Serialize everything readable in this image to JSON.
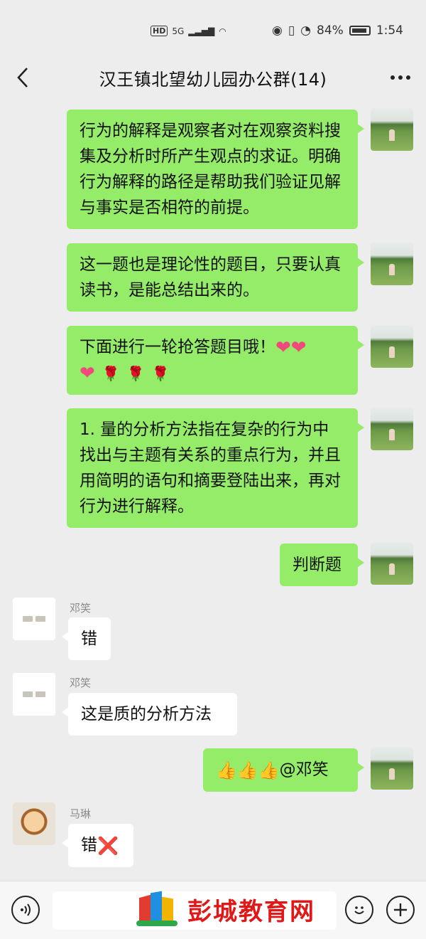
{
  "status_bar": {
    "hd": "HD",
    "network": "5G",
    "battery_percent": "84%",
    "time": "1:54"
  },
  "header": {
    "title": "汉王镇北望幼儿园办公群(14)"
  },
  "messages": [
    {
      "sender": "me",
      "text": "行为的解释是观察者对在观察资料搜集及分析时所产生观点的求证。明确行为解释的路径是帮助我们验证见解与事实是否相符的前提。"
    },
    {
      "sender": "me",
      "text": "这一题也是理论性的题目，只要认真读书，是能总结出来的。"
    },
    {
      "sender": "me",
      "text": "下面进行一轮抢答题目哦！"
    },
    {
      "sender": "me",
      "text": "1. 量的分析方法指在复杂的行为中找出与主题有关系的重点行为，并且用简明的语句和摘要登陆出来，再对行为进行解释。"
    },
    {
      "sender": "me",
      "text": "判断题"
    },
    {
      "sender": "邓笑",
      "text": "错"
    },
    {
      "sender": "邓笑",
      "text": "这是质的分析方法"
    },
    {
      "sender": "me",
      "text": "@邓笑"
    },
    {
      "sender": "马琳",
      "text": "错"
    }
  ],
  "emoji": {
    "heart": "❤",
    "rose": "🌹",
    "thumb": "👍",
    "cross": "❌"
  },
  "watermark": {
    "text": "彭城教育网"
  },
  "icons": [
    "back-icon",
    "more-icon",
    "voice-icon",
    "emoji-icon",
    "plus-icon"
  ]
}
